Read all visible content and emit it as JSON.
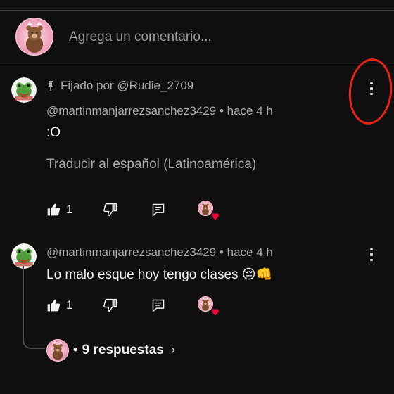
{
  "composer": {
    "placeholder": "Agrega un comentario..."
  },
  "comments": [
    {
      "pinned_label": "Fijado por @Rudie_2709",
      "author": "@martinmanjarrezsanchez3429",
      "separator": "•",
      "time": "hace 4 h",
      "text": ":O",
      "translate": "Traducir al español (Latinoamérica)",
      "likes": "1"
    },
    {
      "author": "@martinmanjarrezsanchez3429",
      "separator": "•",
      "time": "hace 4 h",
      "text": "Lo malo esque hoy tengo clases 😔👊",
      "likes": "1"
    }
  ],
  "replies": {
    "bullet": "•",
    "label": "9 respuestas",
    "chevron": "›"
  },
  "icons": {
    "pin": "pin-icon",
    "like": "thumbs-up-icon",
    "dislike": "thumbs-down-icon",
    "reply": "reply-icon",
    "more": "kebab-menu-icon",
    "heart": "creator-heart-icon"
  },
  "colors": {
    "background": "#0f0f0f",
    "secondary_text": "#aaaaaa",
    "heart": "#ff0033",
    "annotation": "#e8211a"
  }
}
